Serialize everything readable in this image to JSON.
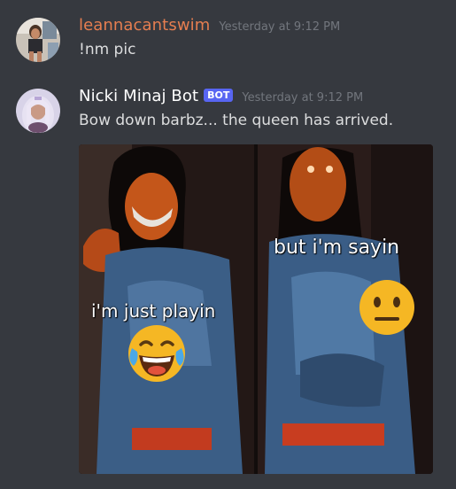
{
  "messages": [
    {
      "username": "leannacantswim",
      "timestamp": "Yesterday at 9:12 PM",
      "text": "!nm pic"
    },
    {
      "username": "Nicki Minaj Bot",
      "bot_tag": "BOT",
      "timestamp": "Yesterday at 9:12 PM",
      "text": "Bow down barbz... the queen has arrived.",
      "image": {
        "caption_left": "i'm just playin",
        "caption_right": "but i'm sayin",
        "emoji_left": "laughing-crying-emoji",
        "emoji_right": "neutral-face-emoji"
      }
    }
  ],
  "colors": {
    "background": "#36393f",
    "username_1": "#e67e50",
    "username_2": "#ffffff",
    "bot_tag": "#5865f2",
    "timestamp": "#72767d",
    "text": "#dcddde"
  }
}
